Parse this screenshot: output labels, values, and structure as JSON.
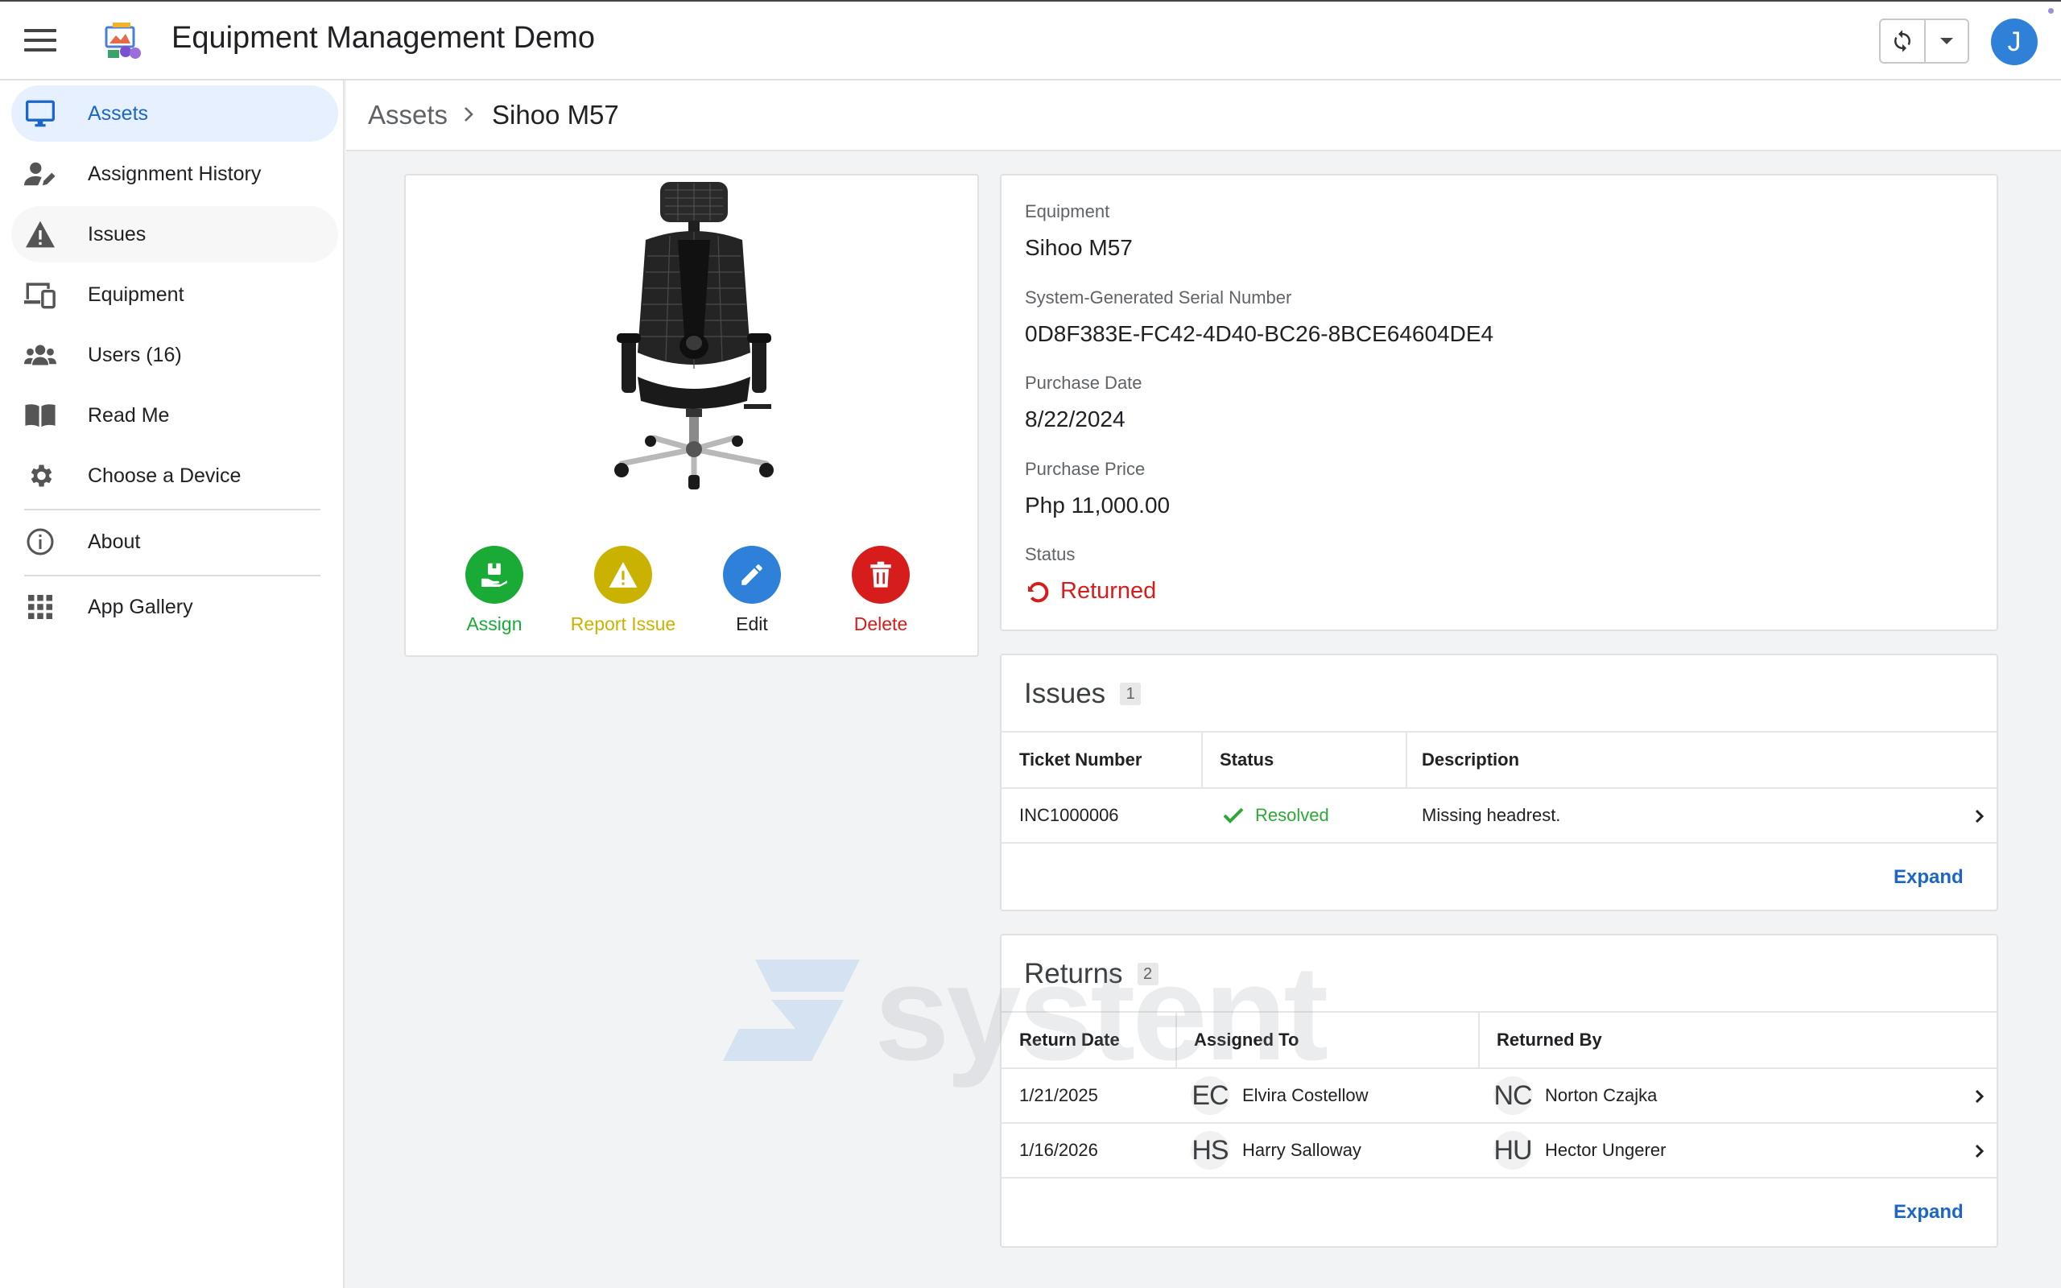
{
  "app": {
    "title": "Equipment Management Demo",
    "user_initial": "J",
    "accent": "#1a66c9"
  },
  "sidebar": {
    "items": [
      {
        "label": "Assets",
        "icon": "monitor-icon"
      },
      {
        "label": "Assignment History",
        "icon": "user-edit-icon"
      },
      {
        "label": "Issues",
        "icon": "warning-icon"
      },
      {
        "label": "Equipment",
        "icon": "devices-icon"
      },
      {
        "label": "Users (16)",
        "icon": "users-icon"
      },
      {
        "label": "Read Me",
        "icon": "book-icon"
      },
      {
        "label": "Choose a Device",
        "icon": "gear-icon"
      },
      {
        "label": "About",
        "icon": "info-icon"
      },
      {
        "label": "App Gallery",
        "icon": "grid-icon"
      }
    ]
  },
  "breadcrumb": {
    "root": "Assets",
    "current": "Sihoo M57"
  },
  "actions": {
    "assign": "Assign",
    "report_issue": "Report Issue",
    "edit": "Edit",
    "delete": "Delete",
    "colors": {
      "assign": "#1aaa36",
      "report_issue": "#c9b200",
      "edit": "#2f80d9",
      "delete": "#d71c1c"
    }
  },
  "details": {
    "equipment_label": "Equipment",
    "equipment_value": "Sihoo M57",
    "serial_label": "System-Generated Serial Number",
    "serial_value": "0D8F383E-FC42-4D40-BC26-8BCE64604DE4",
    "purchase_date_label": "Purchase Date",
    "purchase_date_value": "8/22/2024",
    "purchase_price_label": "Purchase Price",
    "purchase_price_value": "Php 11,000.00",
    "status_label": "Status",
    "status_value": "Returned",
    "status_color": "#d71c1c"
  },
  "issues": {
    "title": "Issues",
    "count": "1",
    "columns": [
      "Ticket Number",
      "Status",
      "Description"
    ],
    "rows": [
      {
        "ticket": "INC1000006",
        "status": "Resolved",
        "description": "Missing headrest."
      }
    ],
    "expand": "Expand"
  },
  "returns": {
    "title": "Returns",
    "count": "2",
    "columns": [
      "Return Date",
      "Assigned To",
      "Returned By"
    ],
    "rows": [
      {
        "date": "1/21/2025",
        "assigned_initials": "EC",
        "assigned_to": "Elvira Costellow",
        "returned_initials": "NC",
        "returned_by": "Norton Czajka"
      },
      {
        "date": "1/16/2026",
        "assigned_initials": "HS",
        "assigned_to": "Harry Salloway",
        "returned_initials": "HU",
        "returned_by": "Hector Ungerer"
      }
    ],
    "expand": "Expand"
  },
  "watermark": "systent"
}
